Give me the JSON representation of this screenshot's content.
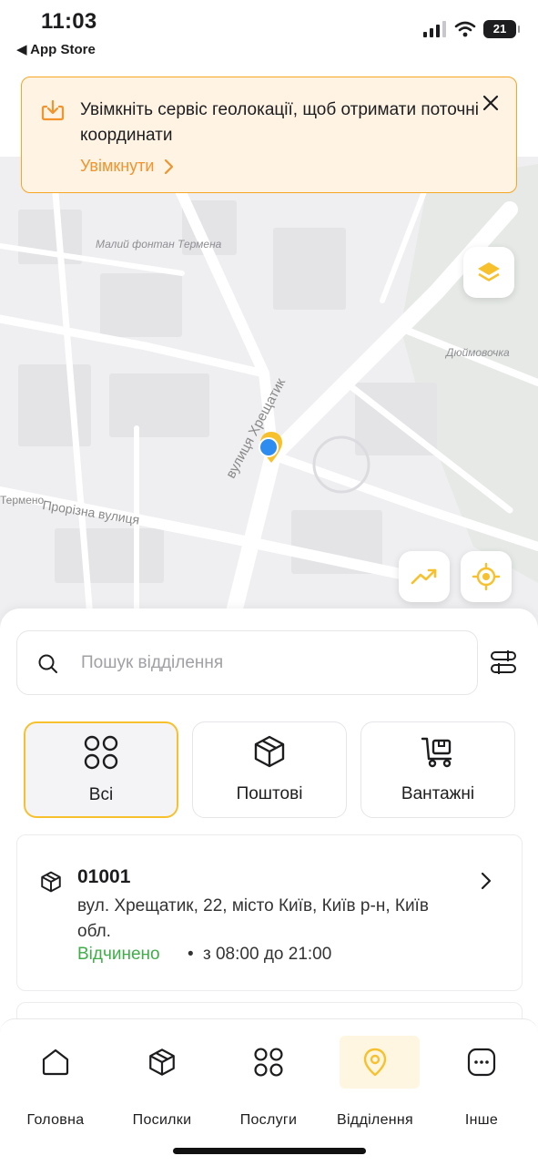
{
  "status_bar": {
    "time": "11:03",
    "back_label": "◀ App Store",
    "battery": "21"
  },
  "banner": {
    "message": "Увімкніть сервіс геолокації, щоб отримати поточні координати",
    "action_label": "Увімкнути",
    "accent_color": "#f2932c",
    "icon": "download-icon"
  },
  "map": {
    "labels": {
      "fountain": "Малий фонтан Термена",
      "park": "Дюймовочка",
      "street_main": "вулиця Хрещатик",
      "street_prorizna": "Прорізна вулиця",
      "termena": "Термено"
    }
  },
  "search": {
    "placeholder": "Пошук відділення",
    "value": ""
  },
  "chips": [
    {
      "label": "Всі",
      "icon": "grid-icon",
      "active": true
    },
    {
      "label": "Поштові",
      "icon": "package-icon",
      "active": false
    },
    {
      "label": "Вантажні",
      "icon": "cart-icon",
      "active": false
    }
  ],
  "branch": {
    "number": "01001",
    "address": "вул. Хрещатик, 22, місто Київ, Київ р-н, Київ обл.",
    "status": "Відчинено",
    "separator": "•",
    "hours": "з 08:00 до 21:00",
    "status_color": "#3fae49"
  },
  "tabs": [
    {
      "label": "Головна",
      "icon": "home-icon",
      "active": false
    },
    {
      "label": "Посилки",
      "icon": "package-icon",
      "active": false
    },
    {
      "label": "Послуги",
      "icon": "grid-icon",
      "active": false
    },
    {
      "label": "Відділення",
      "icon": "location-pin-icon",
      "active": true
    },
    {
      "label": "Інше",
      "icon": "more-icon",
      "active": false
    }
  ],
  "colors": {
    "brand_yellow": "#f7c12e",
    "banner_bg": "#fff3e4",
    "banner_border": "#f5a623"
  }
}
